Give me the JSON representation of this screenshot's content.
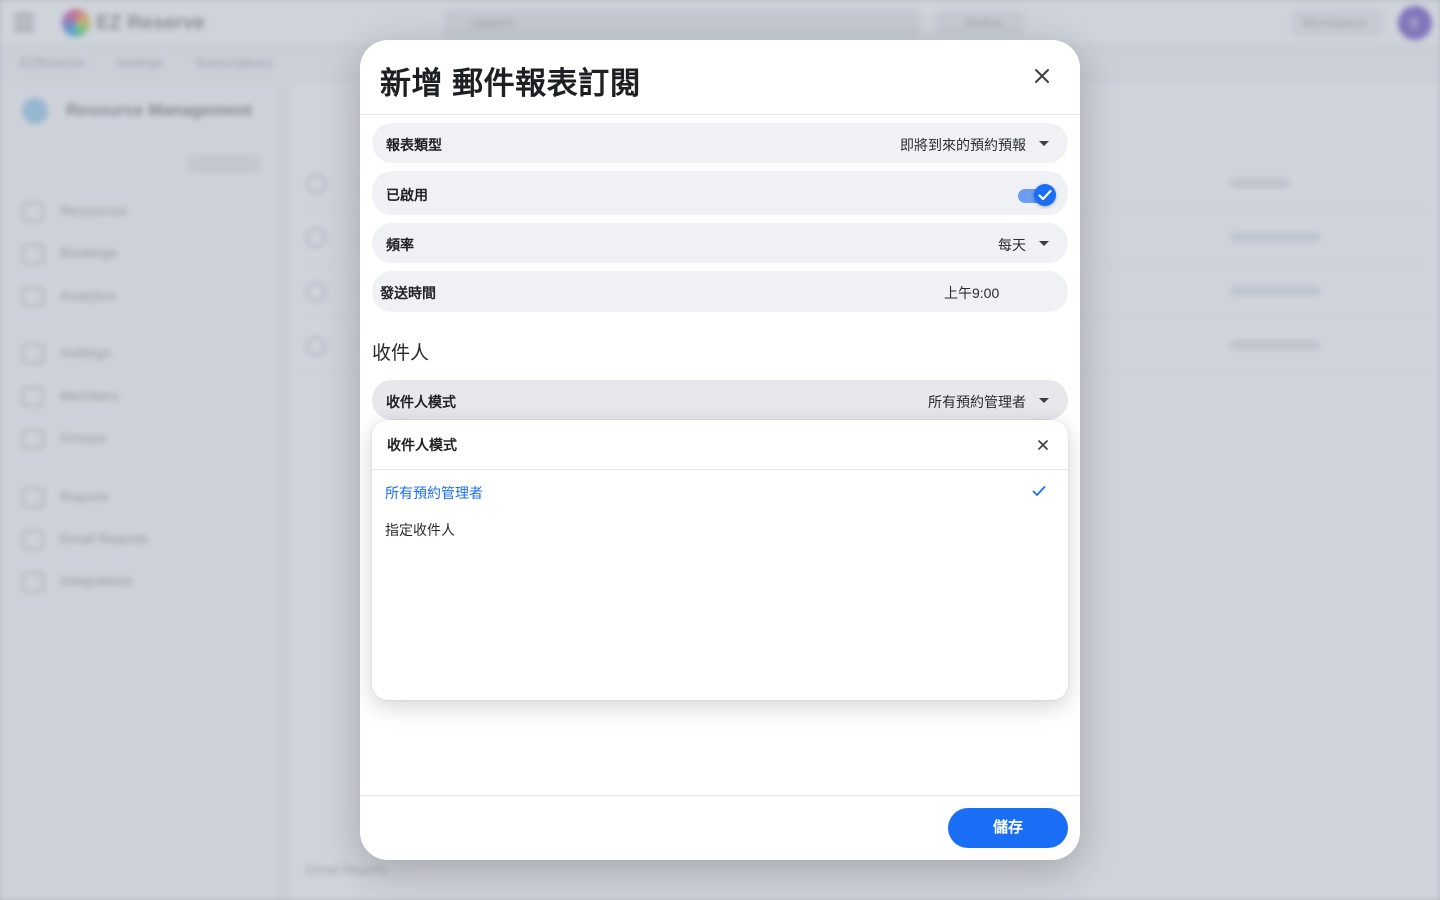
{
  "background": {
    "logo_text": "EZ Reserve",
    "search_placeholder": "Search",
    "notice_label": "Notice",
    "top_dropdown_label": "Workspace",
    "avatar_initial": "E",
    "breadcrumb": "EZReserve Settings Subscriptions",
    "sidebar_header": "Resource Management",
    "sidebar_items": [
      "Resources",
      "Bookings",
      "Analytics",
      "Settings",
      "Members",
      "Groups",
      "Reports",
      "Email Reports",
      "Integrations"
    ],
    "footer_text": "Email Reports"
  },
  "dialog": {
    "title": "新增 郵件報表訂閱",
    "fields": {
      "report_type": {
        "label": "報表類型",
        "value": "即將到來的預約預報"
      },
      "enabled": {
        "label": "已啟用",
        "checked": true
      },
      "frequency": {
        "label": "頻率",
        "value": "每天"
      },
      "send_time": {
        "label": "發送時間",
        "value": "上午9:00"
      }
    },
    "recipients_section_title": "收件人",
    "recipient_mode": {
      "label": "收件人模式",
      "value": "所有預約管理者"
    },
    "menu": {
      "title": "收件人模式",
      "options": [
        {
          "label": "所有預約管理者",
          "selected": true
        },
        {
          "label": "指定收件人",
          "selected": false
        }
      ]
    },
    "save_label": "儲存"
  },
  "colors": {
    "accent": "#1a6ef5",
    "field_background": "#eff1f4",
    "overlay": "#a0a6b4"
  },
  "icons": {
    "close": "close-icon",
    "dropdown": "caret-down-icon",
    "check": "checkmark-icon"
  }
}
